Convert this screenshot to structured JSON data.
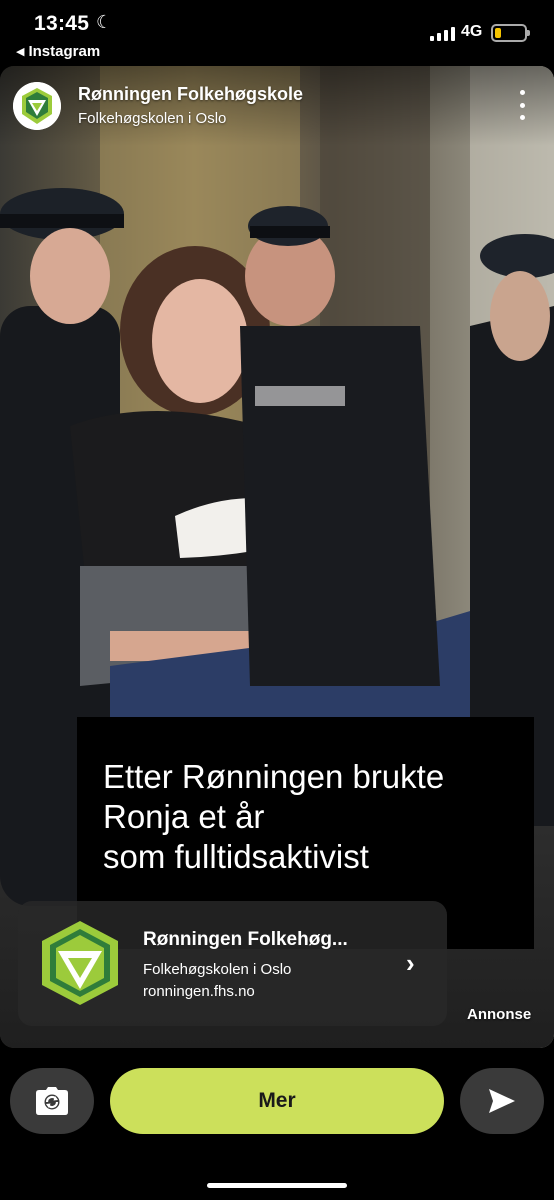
{
  "status_bar": {
    "time": "13:45",
    "back_app": "Instagram",
    "network": "4G",
    "battery_level": 0.2,
    "battery_color": "#f5c400"
  },
  "story": {
    "account_name": "Rønningen Folkehøgskole",
    "account_subtitle": "Folkehøgskolen i Oslo",
    "more_icon": "more-vertical-icon"
  },
  "headline": {
    "line1": "Etter Rønningen brukte",
    "line2": "Ronja et år",
    "line3": "som fulltidsaktivist"
  },
  "ad": {
    "title": "Rønningen Folkehøg...",
    "subtitle": "Folkehøgskolen i Oslo",
    "url": "ronningen.fhs.no",
    "chevron_icon": "chevron-right-icon",
    "label": "Annonse"
  },
  "bottom_bar": {
    "camera_icon": "camera-swap-icon",
    "cta_label": "Mer",
    "cta_color": "#cce05b",
    "send_icon": "send-icon"
  },
  "colors": {
    "logo_green": "#9ccb3b",
    "logo_dark": "#2f7d3a"
  }
}
